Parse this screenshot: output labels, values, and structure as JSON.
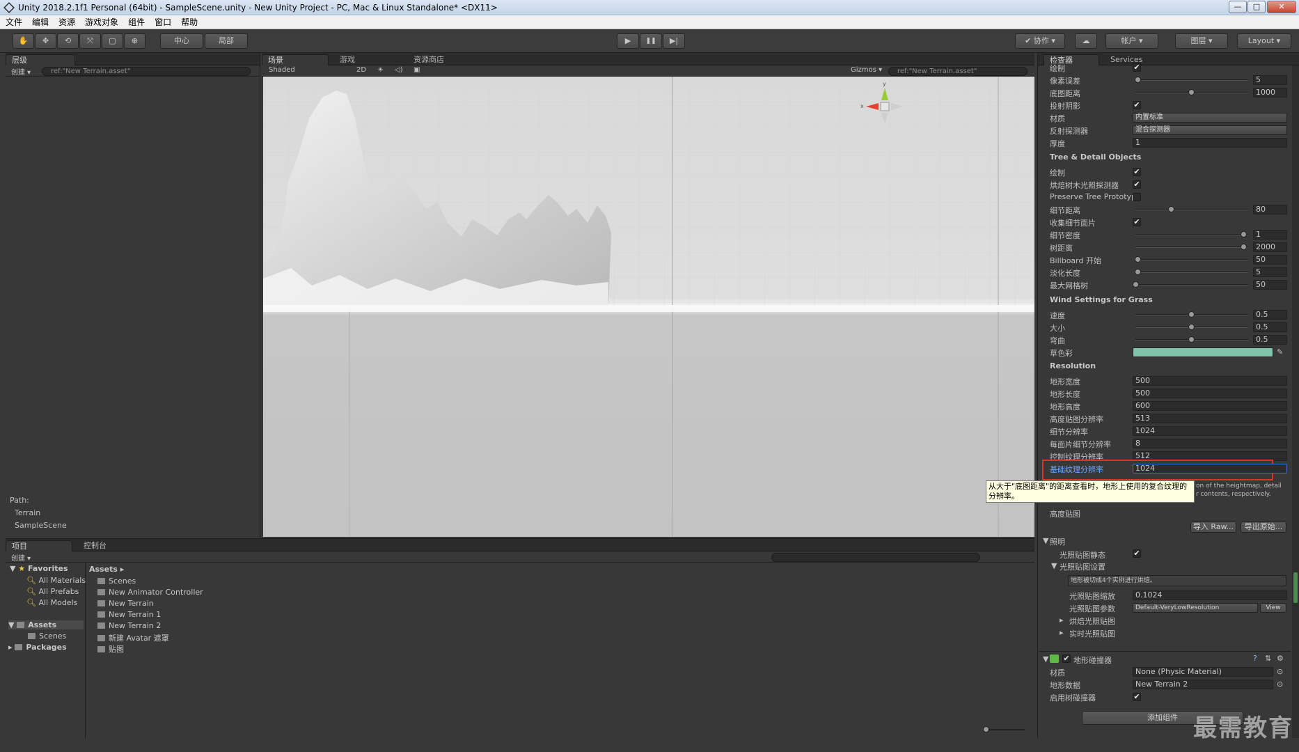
{
  "window": {
    "title": "Unity 2018.2.1f1 Personal (64bit) - SampleScene.unity - New Unity Project - PC, Mac & Linux Standalone* <DX11>",
    "min": "—",
    "max": "□",
    "close": "✕"
  },
  "menu": [
    "文件",
    "编辑",
    "资源",
    "游戏对象",
    "组件",
    "窗口",
    "帮助"
  ],
  "toolbar": {
    "pivot": "中心",
    "space": "局部",
    "play": "▶",
    "pause": "❚❚",
    "step": "▶|",
    "collab": "✔ 协作 ▾",
    "account": "帐户 ▾",
    "layers": "图层 ▾",
    "layout": "Layout ▾"
  },
  "hierarchy": {
    "tab": "层级",
    "create": "创建 ▾",
    "search": "ref:\"New Terrain.asset\"",
    "path_label": "Path:",
    "path": [
      "Terrain",
      "SampleScene"
    ]
  },
  "scene": {
    "tabs": [
      "场景",
      "游戏",
      "资源商店"
    ],
    "shading": "Shaded",
    "mode2d": "2D",
    "gizmos": "Gizmos ▾",
    "search": "ref:\"New Terrain.asset\"",
    "axis_y": "y",
    "axis_x": "x"
  },
  "inspector": {
    "tabs": [
      "检查器",
      "Services"
    ],
    "top_rows": [
      {
        "label": "绘制",
        "kind": "check",
        "value": "✔"
      },
      {
        "label": "像素误差",
        "kind": "slider",
        "value": "5",
        "pos": 0.02
      },
      {
        "label": "底图距离",
        "kind": "slider",
        "value": "1000",
        "pos": 0.5
      },
      {
        "label": "投射阴影",
        "kind": "check",
        "value": "✔"
      },
      {
        "label": "材质",
        "kind": "dropdown",
        "value": "内置标准"
      },
      {
        "label": "反射探测器",
        "kind": "dropdown",
        "value": "混合探测器"
      },
      {
        "label": "厚度",
        "kind": "field",
        "value": "1"
      }
    ],
    "tree_header": "Tree & Detail Objects",
    "tree_rows": [
      {
        "label": "绘制",
        "kind": "check",
        "value": "✔"
      },
      {
        "label": "烘焙树木光照探测器",
        "kind": "check",
        "value": "✔"
      },
      {
        "label": "Preserve Tree Prototyp",
        "kind": "check",
        "value": ""
      },
      {
        "label": "细节距离",
        "kind": "slider",
        "value": "80",
        "pos": 0.32
      },
      {
        "label": "收集细节面片",
        "kind": "check",
        "value": "✔"
      },
      {
        "label": "细节密度",
        "kind": "slider",
        "value": "1",
        "pos": 0.97
      },
      {
        "label": "树距离",
        "kind": "slider",
        "value": "2000",
        "pos": 0.97
      },
      {
        "label": "Billboard 开始",
        "kind": "slider",
        "value": "50",
        "pos": 0.02
      },
      {
        "label": "淡化长度",
        "kind": "slider",
        "value": "5",
        "pos": 0.02
      },
      {
        "label": "最大网格树",
        "kind": "slider",
        "value": "50",
        "pos": 0.0
      }
    ],
    "wind_header": "Wind Settings for Grass",
    "wind_rows": [
      {
        "label": "速度",
        "kind": "slider",
        "value": "0.5",
        "pos": 0.5
      },
      {
        "label": "大小",
        "kind": "slider",
        "value": "0.5",
        "pos": 0.5
      },
      {
        "label": "弯曲",
        "kind": "slider",
        "value": "0.5",
        "pos": 0.5
      },
      {
        "label": "草色彩",
        "kind": "color",
        "value": ""
      }
    ],
    "grass_color": "#7fc4ab",
    "res_header": "Resolution",
    "res_rows": [
      {
        "label": "地形宽度",
        "value": "500"
      },
      {
        "label": "地形长度",
        "value": "500"
      },
      {
        "label": "地形高度",
        "value": "600"
      },
      {
        "label": "高度贴图分辨率",
        "value": "513"
      },
      {
        "label": "细节分辨率",
        "value": "1024"
      },
      {
        "label": "每面片细节分辨率",
        "value": "8"
      },
      {
        "label": "控制纹理分辨率",
        "value": "512"
      }
    ],
    "highlight_row": {
      "label": "基础纹理分辨率",
      "value": "1024"
    },
    "tooltip": "从大于\"底图距离\"的距离查看时，地形上使用的复合纹理的分辨率。",
    "side_note": [
      "on of the heightmap, detail",
      "r contents, respectively."
    ],
    "heightmap_label": "高度贴图",
    "import_raw": "导入 Raw...",
    "export_raw": "导出原始...",
    "lighting_label": "照明",
    "lightmap_static": "光照贴图静态",
    "lightmap_settings": "光照贴图设置",
    "lightmap_hint": "地形被切成4个实例进行烘焙。",
    "lightmap_scale_label": "光照贴图缩放",
    "lightmap_scale": "0.1024",
    "lightmap_params_label": "光照贴图参数",
    "lightmap_params": "Default-VeryLowResolution",
    "view_btn": "View",
    "baked_lightmap": "烘焙光照贴图",
    "realtime_lightmap": "实时光照贴图",
    "collider_title": "地形碰撞器",
    "collider_rows": [
      {
        "label": "材质",
        "value": "None (Physic Material)"
      },
      {
        "label": "地形数据",
        "value": "New Terrain 2"
      },
      {
        "label": "启用树碰撞器",
        "value": "✔"
      }
    ],
    "add_component": "添加组件"
  },
  "project": {
    "tabs": [
      "项目",
      "控制台"
    ],
    "create": "创建 ▾",
    "favorites": "Favorites",
    "fav_items": [
      "All Materials",
      "All Prefabs",
      "All Models"
    ],
    "assets": "Assets",
    "assets_children": [
      "Scenes"
    ],
    "packages": "Packages",
    "breadcrumb": "Assets ▸",
    "files": [
      "Scenes",
      "New Animator Controller",
      "New Terrain",
      "New Terrain 1",
      "New Terrain 2",
      "新建 Avatar 遮罩",
      "贴图"
    ]
  },
  "watermark": "最需教育"
}
